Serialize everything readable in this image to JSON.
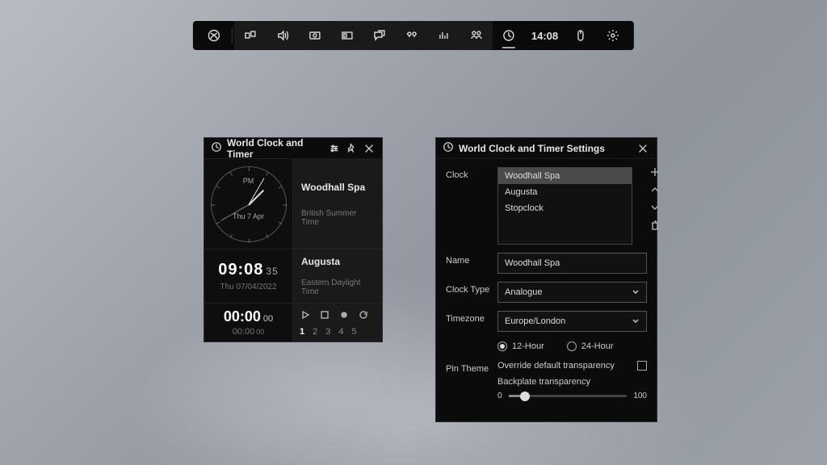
{
  "gamebar": {
    "time": "14:08"
  },
  "clockWidget": {
    "title": "World Clock and Timer",
    "analogue": {
      "ampm": "PM",
      "date": "Thu 7 Apr"
    },
    "loc1": {
      "name": "Woodhall Spa",
      "tz": "British Summer Time"
    },
    "digital": {
      "time": "09:08",
      "seconds": "35",
      "date": "Thu 07/04/2022"
    },
    "loc2": {
      "name": "Augusta",
      "tz": "Eastern Daylight Time"
    },
    "timer": {
      "main": "00:00",
      "mainCs": "00",
      "sub": "00:00",
      "subCs": "00"
    },
    "laps": [
      "1",
      "2",
      "3",
      "4",
      "5"
    ]
  },
  "settings": {
    "title": "World Clock and Timer Settings",
    "labels": {
      "clock": "Clock",
      "name": "Name",
      "clockType": "Clock Type",
      "timezone": "Timezone",
      "pinTheme": "Pin Theme"
    },
    "clockList": [
      "Woodhall Spa",
      "Augusta",
      "Stopclock"
    ],
    "nameValue": "Woodhall Spa",
    "clockTypeValue": "Analogue",
    "timezoneValue": "Europe/London",
    "hour12": "12-Hour",
    "hour24": "24-Hour",
    "overrideLabel": "Override default transparency",
    "backplateLabel": "Backplate transparency",
    "sliderMin": "0",
    "sliderMax": "100"
  }
}
